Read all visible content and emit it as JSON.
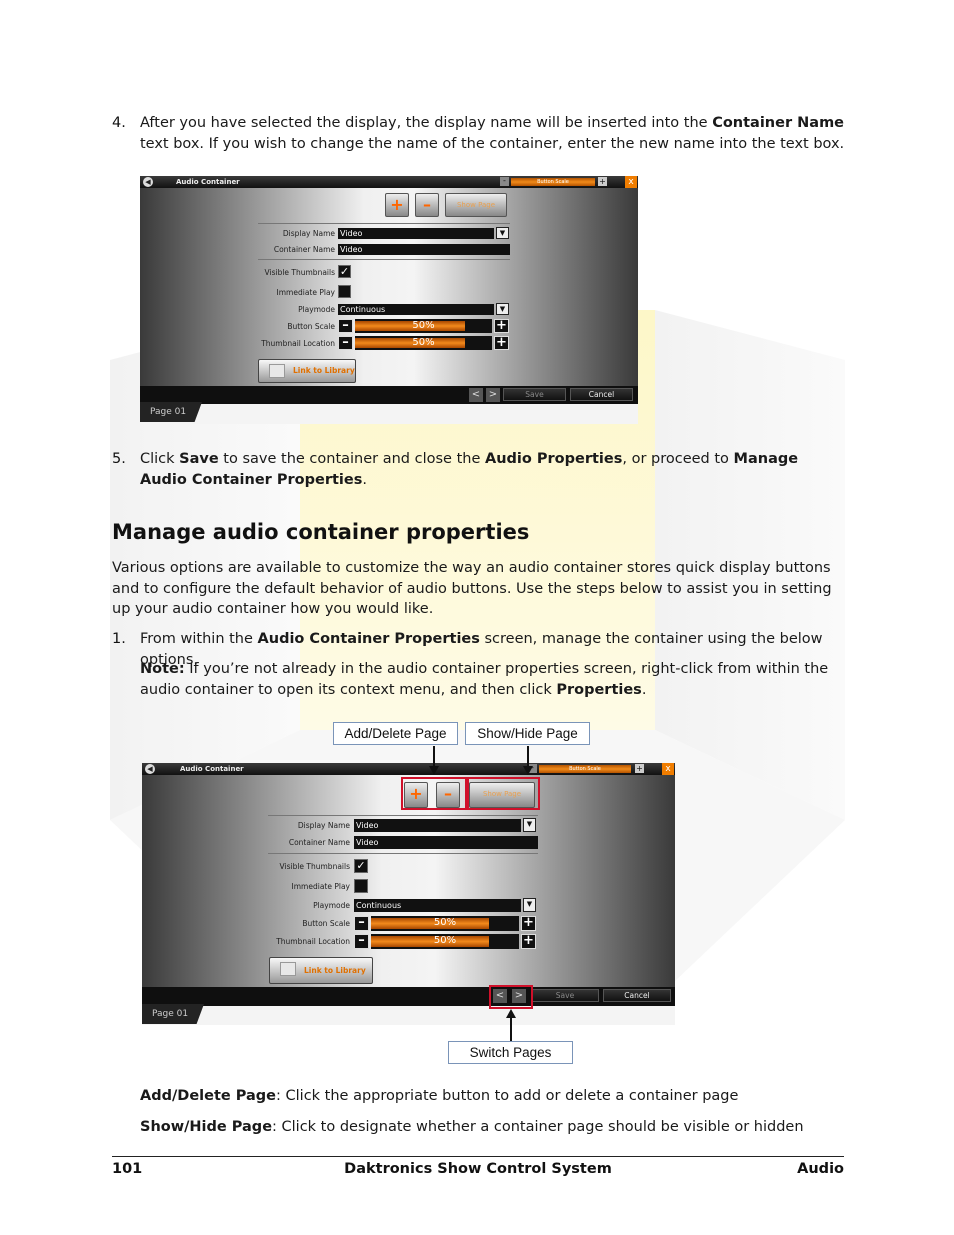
{
  "step4": {
    "number": "4.",
    "text_a": "After you have selected the display, the display name will be inserted into the ",
    "bold": "Container Name",
    "text_b": " text box. If you wish to change the name of the container, enter the new name into the text box."
  },
  "step5": {
    "number": "5.",
    "t1": "Click ",
    "b1": "Save",
    "t2": " to save the container and close the ",
    "b2": "Audio Properties",
    "t3": ", or proceed to ",
    "b3": "Manage Audio Container Properties",
    "t4": "."
  },
  "heading": "Manage audio container properties",
  "intro": "Various options are available to customize the way an audio container stores quick display buttons and to configure the default behavior of audio buttons. Use the steps below to assist you in setting up your audio container how you would like.",
  "step1": {
    "number": "1.",
    "t1": "From within the ",
    "b1": "Audio Container Properties",
    "t2": " screen, manage the container using the below options."
  },
  "note": {
    "label": "Note:",
    "t1": " If you’re not already in the audio container properties screen, right-click from within the audio container to open its context menu, and then click ",
    "b1": "Properties",
    "t2": "."
  },
  "app": {
    "title": "Audio Container",
    "button_scale": "Button Scale",
    "close": "x",
    "add_icon": "+",
    "delete_icon": "–",
    "show_page": "Show Page",
    "display_name_label": "Display Name",
    "display_name_value": "Video",
    "container_name_label": "Container Name",
    "container_name_value": "Video",
    "visible_thumbnails_label": "Visible Thumbnails",
    "check_mark": "✓",
    "immediate_play_label": "Immediate Play",
    "playmode_label": "Playmode",
    "playmode_value": "Continuous",
    "button_scale_label": "Button Scale",
    "button_scale_value": "50%",
    "thumbnail_location_label": "Thumbnail Location",
    "thumbnail_location_value": "50%",
    "link_to_library": "Link to Library",
    "prev": "<",
    "next": ">",
    "save": "Save",
    "cancel": "Cancel",
    "page_tab": "Page 01",
    "scale_fraction": 0.5
  },
  "callouts": {
    "add_delete": "Add/Delete Page",
    "show_hide": "Show/Hide Page",
    "switch_pages": "Switch Pages"
  },
  "desc": {
    "add_delete_label": "Add/Delete Page",
    "add_delete_text": ": Click the appropriate button to add or delete a container page",
    "show_hide_label": "Show/Hide Page",
    "show_hide_text": ": Click to designate whether a container page should be visible or hidden"
  },
  "footer": {
    "page_number": "101",
    "center": "Daktronics Show Control System",
    "right": "Audio"
  },
  "colors": {
    "accent_orange": "#f07d00",
    "callout_red": "#d0102a",
    "watermark_yellow": "#fdf6b0"
  }
}
